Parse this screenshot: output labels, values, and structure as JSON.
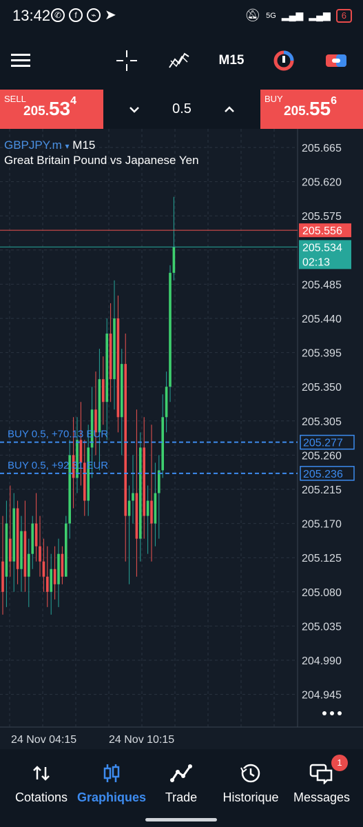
{
  "status_bar": {
    "time": "13:42",
    "left_icons": [
      "whatsapp-icon",
      "facebook-icon",
      "messenger-icon",
      "telegram-icon"
    ],
    "right_icons": [
      "mute-icon",
      "signal-icon",
      "signal-icon"
    ],
    "signal_label": "5G",
    "battery": "6"
  },
  "toolbar": {
    "timeframe": "M15",
    "icons": [
      "menu-icon",
      "crosshair-icon",
      "indicators-icon",
      "timeframe",
      "one-click-icon",
      "trade-icon"
    ]
  },
  "trade_bar": {
    "sell_label": "SELL",
    "sell_price_main": "205.",
    "sell_price_big": "53",
    "sell_price_sup": "4",
    "buy_label": "BUY",
    "buy_price_main": "205.",
    "buy_price_big": "55",
    "buy_price_sup": "6",
    "lot": "0.5"
  },
  "chart": {
    "symbol": "GBPJPY.m",
    "symbol_arrow": "▾",
    "timeframe": "M15",
    "description": "Great Britain Pound vs Japanese Yen",
    "ask_price": "205.556",
    "bid_price": "205.534",
    "countdown": "02:13",
    "position_lines": [
      {
        "label": "BUY 0.5,   +70.13 EUR",
        "price": "205.277"
      },
      {
        "label": "BUY 0.5,   +92.31 EUR",
        "price": "205.236"
      }
    ],
    "more_icon": "more-icon",
    "colors": {
      "bull": "#26a69a",
      "bear": "#ef5350",
      "ask_line": "#ef5350",
      "bid_line": "#26a69a",
      "position_line": "#3d8bef",
      "grid": "#2a3340"
    }
  },
  "chart_data": {
    "type": "candlestick",
    "y_ticks": [
      "205.665",
      "205.620",
      "205.575",
      "205.530",
      "205.485",
      "205.440",
      "205.395",
      "205.350",
      "205.305",
      "205.260",
      "205.215",
      "205.170",
      "205.125",
      "205.080",
      "205.035",
      "204.990",
      "204.945"
    ],
    "x_ticks": [
      "24 Nov 04:15",
      "24 Nov 10:15"
    ],
    "ylim": [
      204.92,
      205.69
    ],
    "candles": [
      {
        "o": 205.12,
        "h": 205.18,
        "l": 205.05,
        "c": 205.08
      },
      {
        "o": 205.1,
        "h": 205.2,
        "l": 205.06,
        "c": 205.17
      },
      {
        "o": 205.15,
        "h": 205.22,
        "l": 205.1,
        "c": 205.12
      },
      {
        "o": 205.12,
        "h": 205.21,
        "l": 205.08,
        "c": 205.19
      },
      {
        "o": 205.19,
        "h": 205.2,
        "l": 205.09,
        "c": 205.11
      },
      {
        "o": 205.11,
        "h": 205.18,
        "l": 205.08,
        "c": 205.16
      },
      {
        "o": 205.16,
        "h": 205.2,
        "l": 205.08,
        "c": 205.1
      },
      {
        "o": 205.1,
        "h": 205.15,
        "l": 205.06,
        "c": 205.13
      },
      {
        "o": 205.13,
        "h": 205.18,
        "l": 205.11,
        "c": 205.17
      },
      {
        "o": 205.17,
        "h": 205.21,
        "l": 205.12,
        "c": 205.14
      },
      {
        "o": 205.14,
        "h": 205.18,
        "l": 205.1,
        "c": 205.12
      },
      {
        "o": 205.12,
        "h": 205.15,
        "l": 205.08,
        "c": 205.1
      },
      {
        "o": 205.1,
        "h": 205.14,
        "l": 205.06,
        "c": 205.08
      },
      {
        "o": 205.08,
        "h": 205.13,
        "l": 205.05,
        "c": 205.11
      },
      {
        "o": 205.11,
        "h": 205.14,
        "l": 205.07,
        "c": 205.09
      },
      {
        "o": 205.09,
        "h": 205.15,
        "l": 205.06,
        "c": 205.13
      },
      {
        "o": 205.13,
        "h": 205.14,
        "l": 205.09,
        "c": 205.1
      },
      {
        "o": 205.1,
        "h": 205.18,
        "l": 205.1,
        "c": 205.17
      },
      {
        "o": 205.17,
        "h": 205.28,
        "l": 205.15,
        "c": 205.26
      },
      {
        "o": 205.26,
        "h": 205.31,
        "l": 205.19,
        "c": 205.23
      },
      {
        "o": 205.23,
        "h": 205.31,
        "l": 205.21,
        "c": 205.28
      },
      {
        "o": 205.28,
        "h": 205.33,
        "l": 205.22,
        "c": 205.25
      },
      {
        "o": 205.25,
        "h": 205.28,
        "l": 205.18,
        "c": 205.2
      },
      {
        "o": 205.2,
        "h": 205.3,
        "l": 205.18,
        "c": 205.27
      },
      {
        "o": 205.27,
        "h": 205.35,
        "l": 205.23,
        "c": 205.32
      },
      {
        "o": 205.32,
        "h": 205.37,
        "l": 205.26,
        "c": 205.29
      },
      {
        "o": 205.29,
        "h": 205.4,
        "l": 205.24,
        "c": 205.36
      },
      {
        "o": 205.36,
        "h": 205.39,
        "l": 205.3,
        "c": 205.33
      },
      {
        "o": 205.33,
        "h": 205.44,
        "l": 205.28,
        "c": 205.42
      },
      {
        "o": 205.42,
        "h": 205.46,
        "l": 205.33,
        "c": 205.36
      },
      {
        "o": 205.36,
        "h": 205.49,
        "l": 205.32,
        "c": 205.44
      },
      {
        "o": 205.44,
        "h": 205.47,
        "l": 205.29,
        "c": 205.31
      },
      {
        "o": 205.31,
        "h": 205.4,
        "l": 205.26,
        "c": 205.38
      },
      {
        "o": 205.38,
        "h": 205.42,
        "l": 205.12,
        "c": 205.18
      },
      {
        "o": 205.18,
        "h": 205.22,
        "l": 205.09,
        "c": 205.2
      },
      {
        "o": 205.2,
        "h": 205.26,
        "l": 205.17,
        "c": 205.21
      },
      {
        "o": 205.21,
        "h": 205.32,
        "l": 205.1,
        "c": 205.15
      },
      {
        "o": 205.15,
        "h": 205.29,
        "l": 205.12,
        "c": 205.27
      },
      {
        "o": 205.27,
        "h": 205.31,
        "l": 205.15,
        "c": 205.18
      },
      {
        "o": 205.18,
        "h": 205.22,
        "l": 205.13,
        "c": 205.2
      },
      {
        "o": 205.2,
        "h": 205.3,
        "l": 205.12,
        "c": 205.17
      },
      {
        "o": 205.17,
        "h": 205.25,
        "l": 205.14,
        "c": 205.21
      },
      {
        "o": 205.21,
        "h": 205.26,
        "l": 205.15,
        "c": 205.24
      },
      {
        "o": 205.24,
        "h": 205.34,
        "l": 205.23,
        "c": 205.31
      },
      {
        "o": 205.31,
        "h": 205.37,
        "l": 205.29,
        "c": 205.35
      },
      {
        "o": 205.35,
        "h": 205.51,
        "l": 205.33,
        "c": 205.5
      },
      {
        "o": 205.5,
        "h": 205.6,
        "l": 205.49,
        "c": 205.534
      }
    ]
  },
  "bottom_nav": [
    {
      "label": "Cotations",
      "icon": "quotes-icon",
      "active": false
    },
    {
      "label": "Graphiques",
      "icon": "charts-icon",
      "active": true
    },
    {
      "label": "Trade",
      "icon": "trade-chart-icon",
      "active": false
    },
    {
      "label": "Historique",
      "icon": "history-icon",
      "active": false
    },
    {
      "label": "Messages",
      "icon": "messages-icon",
      "active": false,
      "badge": "1"
    }
  ]
}
